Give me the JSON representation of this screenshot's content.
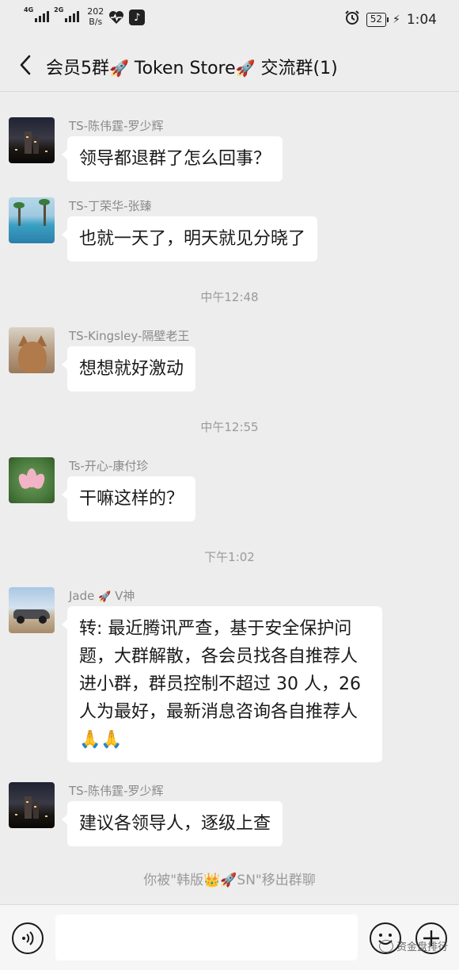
{
  "status_bar": {
    "signal1_label": "4G",
    "signal2_label": "2G",
    "speed_value": "202",
    "speed_unit": "B/s",
    "battery": "52",
    "time": "1:04"
  },
  "header": {
    "title_part1": "会员5群",
    "title_part2": " Token Store",
    "title_part3": " 交流群(1)"
  },
  "messages": [
    {
      "sender": "TS-陈伟霆-罗少辉",
      "text": "领导都退群了怎么回事？"
    },
    {
      "sender": "TS-丁荣华-张臻",
      "text": "也就一天了，明天就见分晓了"
    },
    {
      "sender": "TS-Kingsley-隔壁老王",
      "text": "想想就好激动"
    },
    {
      "sender": "Ts-开心-康付珍",
      "text": "干嘛这样的？"
    },
    {
      "sender_part1": "Jade",
      "sender_part2": "V神",
      "text": "转: 最近腾讯严查，基于安全保护问题，大群解散，各会员找各自推荐人进小群，群员控制不超过 30 人，26 人为最好，最新消息咨询各自推荐人"
    },
    {
      "sender": "TS-陈伟霆-罗少辉",
      "text": "建议各领导人，逐级上查"
    }
  ],
  "timestamps": [
    "中午12:48",
    "中午12:55",
    "下午1:02"
  ],
  "system": {
    "part1": "你被\"韩版",
    "part2": "SN\"移出群聊"
  },
  "input": {
    "value": ""
  },
  "watermark": "资金盘排行",
  "colors": {
    "background": "#ededed",
    "bubble": "#ffffff",
    "meta_text": "#9a9a9a"
  }
}
